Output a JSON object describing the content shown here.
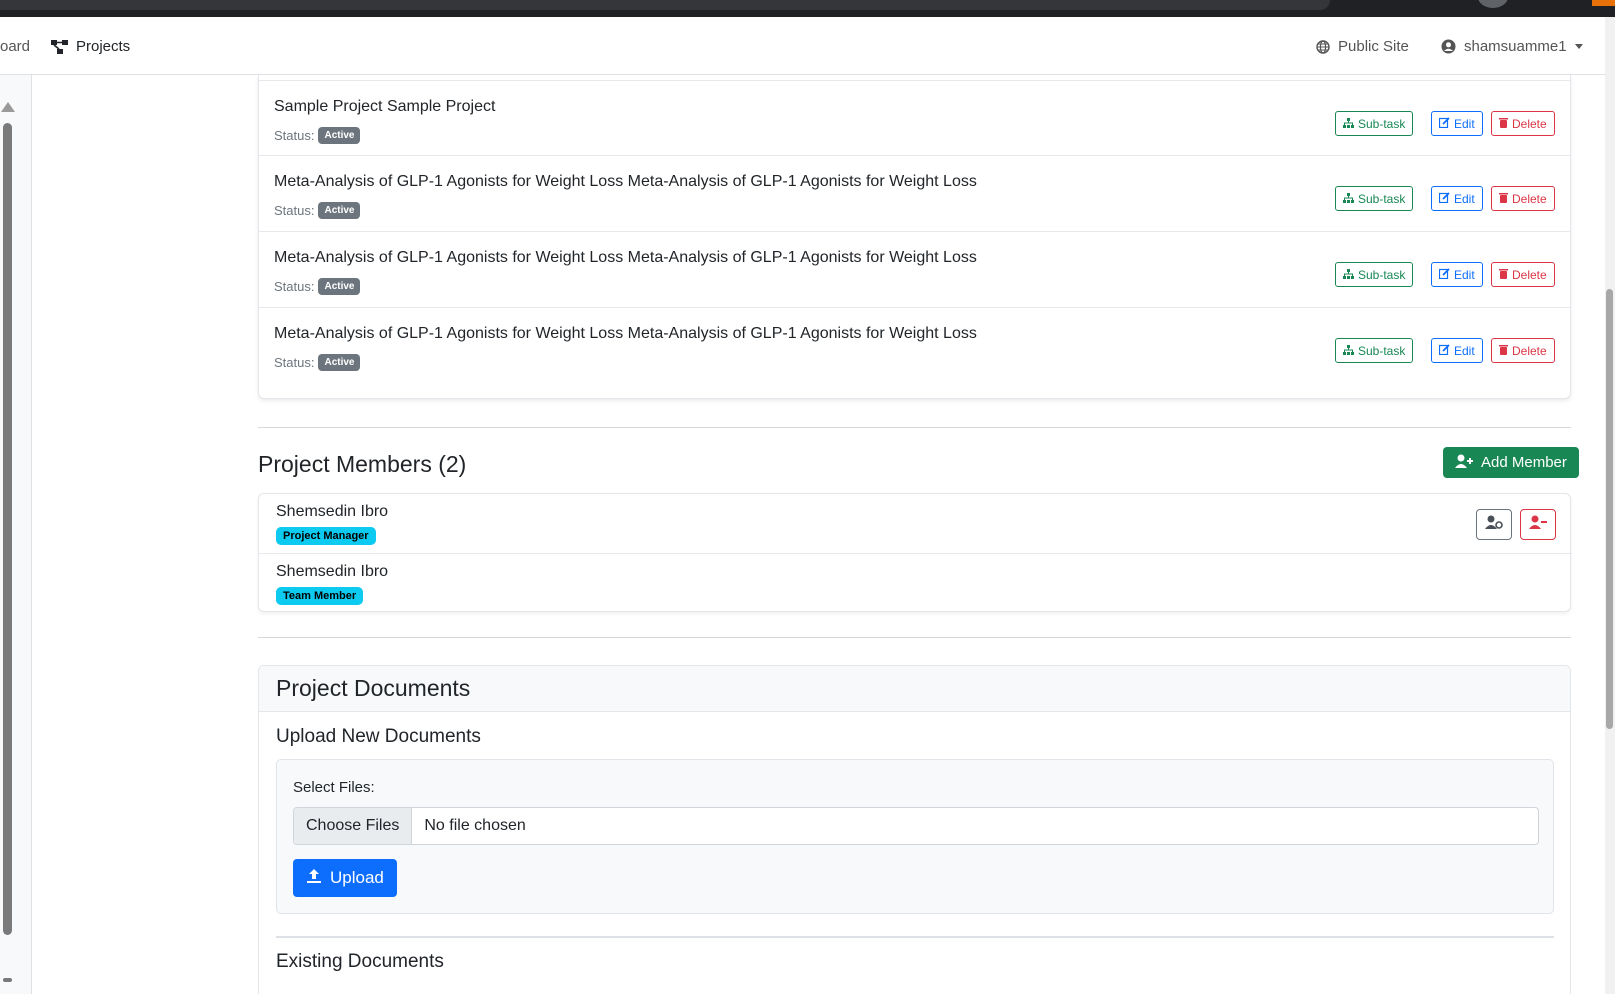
{
  "nav": {
    "dashboard_partial": "oard",
    "projects": "Projects",
    "public_site": "Public Site",
    "user": "shamsuamme1"
  },
  "tasks": {
    "status_label": "Status:",
    "items": [
      {
        "title": "Sample Project Sample Project",
        "status": "Active"
      },
      {
        "title": "Meta-Analysis of GLP-1 Agonists for Weight Loss Meta-Analysis of GLP-1 Agonists for Weight Loss",
        "status": "Active"
      },
      {
        "title": "Meta-Analysis of GLP-1 Agonists for Weight Loss Meta-Analysis of GLP-1 Agonists for Weight Loss",
        "status": "Active"
      },
      {
        "title": "Meta-Analysis of GLP-1 Agonists for Weight Loss Meta-Analysis of GLP-1 Agonists for Weight Loss",
        "status": "Active"
      }
    ],
    "subtask_label": "Sub-task",
    "edit_label": "Edit",
    "delete_label": "Delete"
  },
  "members": {
    "title": "Project Members (2)",
    "add_button": "Add Member",
    "items": [
      {
        "name": "Shemsedin Ibro",
        "role": "Project Manager"
      },
      {
        "name": "Shemsedin Ibro",
        "role": "Team Member"
      }
    ]
  },
  "documents": {
    "title": "Project Documents",
    "upload_title": "Upload New Documents",
    "select_label": "Select Files:",
    "choose_button": "Choose Files",
    "file_status": "No file chosen",
    "upload_button": "Upload",
    "existing_title": "Existing Documents"
  },
  "colors": {
    "success": "#198754",
    "primary": "#0d6efd",
    "danger": "#dc3545",
    "info": "#0dcaf0",
    "secondary": "#6c757d"
  },
  "icons": {
    "projects": "project-diagram-icon",
    "public_site": "globe-icon",
    "user": "user-circle-icon",
    "subtask": "sitemap-icon",
    "edit": "edit-icon",
    "delete": "trash-icon",
    "add_member": "user-plus-icon",
    "change_role": "user-cog-icon",
    "remove_member": "user-minus-icon",
    "upload": "upload-icon"
  }
}
